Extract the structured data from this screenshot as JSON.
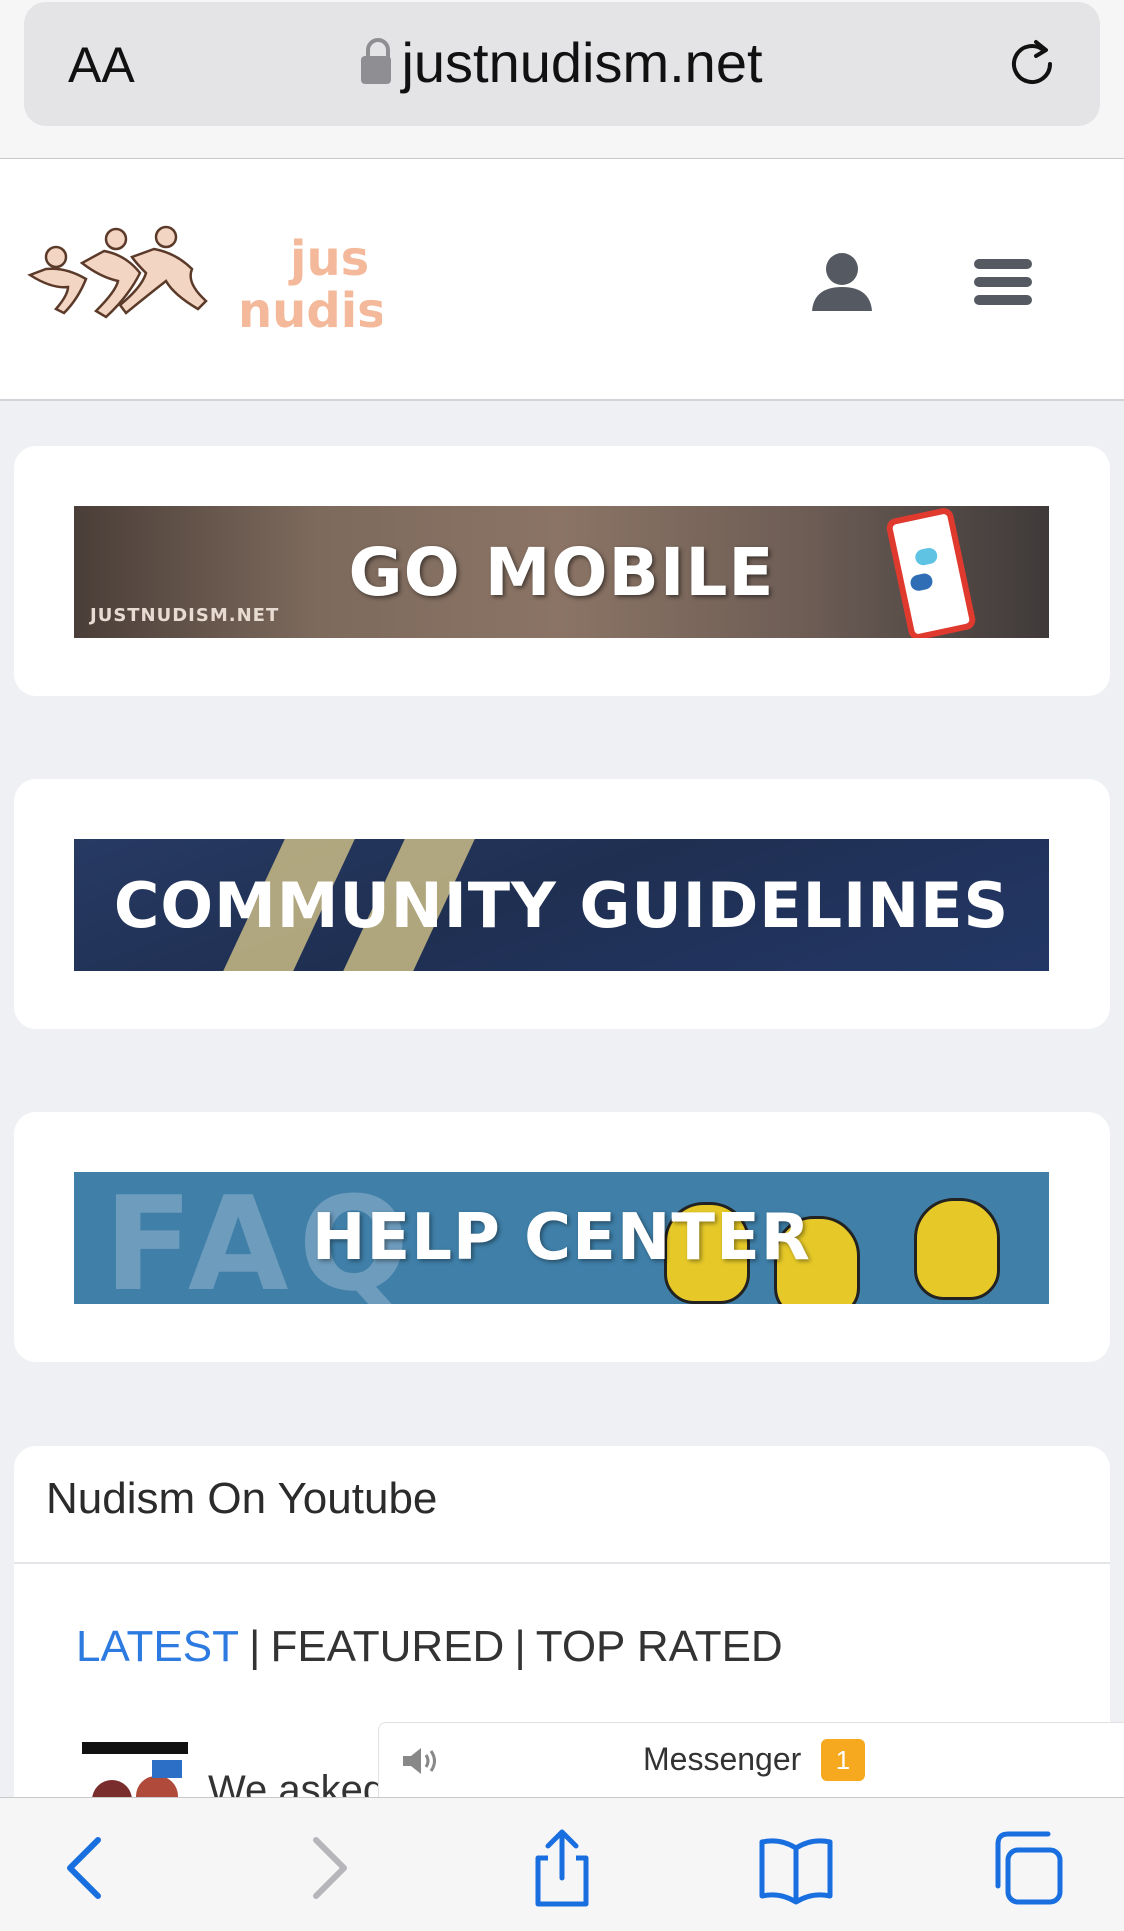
{
  "browser": {
    "text_size_label": "AA",
    "url": "justnudism.net"
  },
  "site": {
    "logo_text_line1": "jus",
    "logo_text_line2": "nudis"
  },
  "banners": [
    {
      "title": "GO MOBILE",
      "subtitle": "JUSTNUDISM.NET"
    },
    {
      "title": "COMMUNITY GUIDELINES"
    },
    {
      "title": "HELP CENTER",
      "background_text": "FAQ"
    }
  ],
  "youtube": {
    "title": "Nudism On Youtube",
    "tabs": [
      "LATEST",
      "FEATURED",
      "TOP RATED"
    ],
    "video_preview_text": "We asked"
  },
  "messenger": {
    "label": "Messenger",
    "badge_count": "1"
  },
  "icons": {
    "reload": "reload-icon",
    "lock": "lock-icon",
    "user": "user-icon",
    "menu": "hamburger-menu-icon",
    "back": "back-arrow-icon",
    "forward": "forward-arrow-icon",
    "share": "share-icon",
    "bookmarks": "bookmarks-icon",
    "tabs": "tabs-icon",
    "speaker": "speaker-icon"
  },
  "colors": {
    "active_tab": "#2d7be0",
    "toolbar_icon": "#1a6fe0",
    "badge": "#f6a91e",
    "logo": "#f3b99a"
  }
}
